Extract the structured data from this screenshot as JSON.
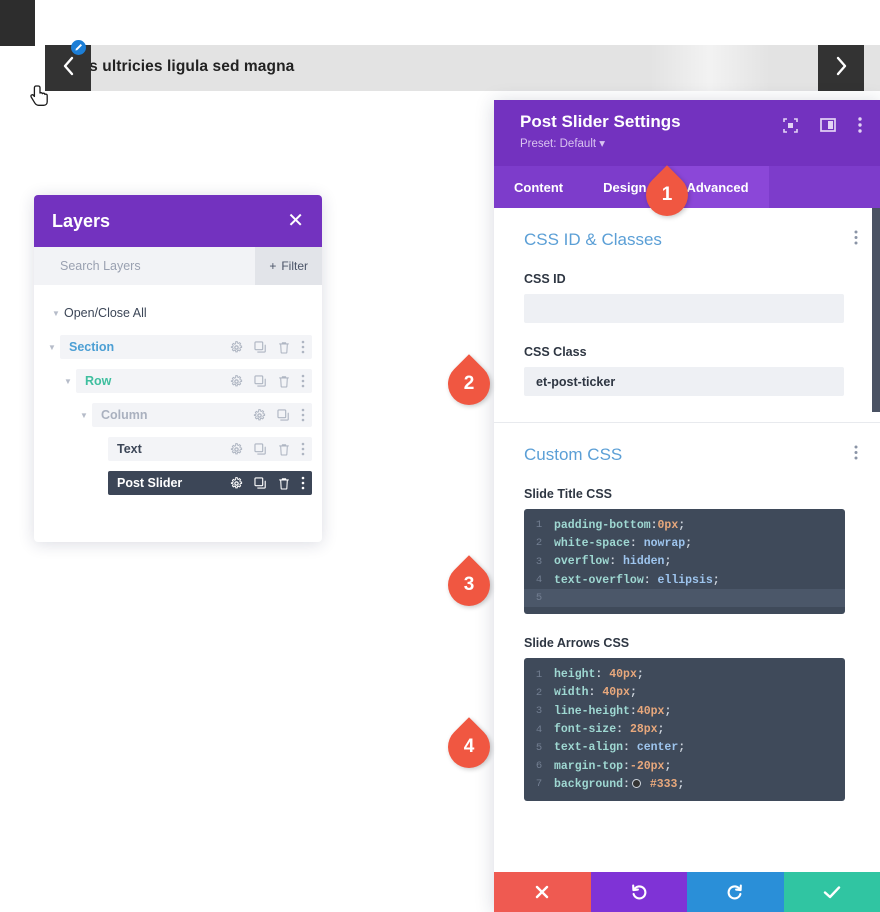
{
  "slider": {
    "title": "Cras ultricies ligula sed magna",
    "prev_arrow_icon": "chevron-left-icon",
    "next_arrow_icon": "chevron-right-icon",
    "badge_icon": "edit-pencil-icon"
  },
  "layers": {
    "title": "Layers",
    "close_label": "✕",
    "search_placeholder": "Search Layers",
    "search_value": "",
    "filter_label": "Filter",
    "filter_plus": "+",
    "open_close_all": "Open/Close All",
    "items": [
      {
        "label": "Section",
        "type": "section",
        "depth": 0,
        "has_caret": true,
        "has_delete": true,
        "selected": false
      },
      {
        "label": "Row",
        "type": "row",
        "depth": 1,
        "has_caret": true,
        "has_delete": true,
        "selected": false
      },
      {
        "label": "Column",
        "type": "column",
        "depth": 2,
        "has_caret": true,
        "has_delete": false,
        "selected": false
      },
      {
        "label": "Text",
        "type": "text",
        "depth": 3,
        "has_caret": false,
        "has_delete": true,
        "selected": false
      },
      {
        "label": "Post Slider",
        "type": "module",
        "depth": 3,
        "has_caret": false,
        "has_delete": true,
        "selected": true
      }
    ],
    "row_icons": [
      "gear-icon",
      "duplicate-icon",
      "trash-icon",
      "dots-vertical-icon"
    ],
    "accent": "#7332bf"
  },
  "settings": {
    "title": "Post Slider Settings",
    "preset": "Preset: Default ▾",
    "header_icons": [
      "expand-icon",
      "layout-panel-icon",
      "dots-vertical-icon"
    ],
    "tabs": [
      {
        "label": "Content",
        "active": false
      },
      {
        "label": "Design",
        "active": false
      },
      {
        "label": "Advanced",
        "active": true
      }
    ],
    "accent": "#7332bf",
    "tab_bar_color": "#7d3ccb",
    "sections": [
      {
        "heading": "CSS ID & Classes",
        "fields": [
          {
            "label": "CSS ID",
            "value": "",
            "name": "css-id-input"
          },
          {
            "label": "CSS Class",
            "value": "et-post-ticker",
            "name": "css-class-input"
          }
        ]
      },
      {
        "heading": "Custom CSS",
        "editors": [
          {
            "label": "Slide Title CSS",
            "name": "slide-title-css-editor",
            "lines": [
              {
                "n": "1",
                "prop": "padding-bottom",
                "sep": ":",
                "val": "0px",
                "val_kind": "num",
                "end": ";"
              },
              {
                "n": "2",
                "prop": "white-space",
                "sep": ": ",
                "val": "nowrap",
                "val_kind": "val",
                "end": ";"
              },
              {
                "n": "3",
                "prop": "overflow",
                "sep": ": ",
                "val": "hidden",
                "val_kind": "val",
                "end": ";"
              },
              {
                "n": "4",
                "prop": "text-overflow",
                "sep": ": ",
                "val": "ellipsis",
                "val_kind": "val",
                "end": ";"
              },
              {
                "n": "5",
                "prop": "",
                "sep": "",
                "val": "",
                "val_kind": "cursor",
                "end": ""
              }
            ]
          },
          {
            "label": "Slide Arrows CSS",
            "name": "slide-arrows-css-editor",
            "lines": [
              {
                "n": "1",
                "prop": "height",
                "sep": ": ",
                "val": "40px",
                "val_kind": "num",
                "end": ";"
              },
              {
                "n": "2",
                "prop": "width",
                "sep": ": ",
                "val": "40px",
                "val_kind": "num",
                "end": ";"
              },
              {
                "n": "3",
                "prop": "line-height",
                "sep": ":",
                "val": "40px",
                "val_kind": "num",
                "end": ";"
              },
              {
                "n": "4",
                "prop": "font-size",
                "sep": ": ",
                "val": "28px",
                "val_kind": "num",
                "end": ";"
              },
              {
                "n": "5",
                "prop": "text-align",
                "sep": ": ",
                "val": "center",
                "val_kind": "val",
                "end": ";"
              },
              {
                "n": "6",
                "prop": "margin-top",
                "sep": ":",
                "val": "-20px",
                "val_kind": "num",
                "end": ";"
              },
              {
                "n": "7",
                "prop": "background",
                "sep": ":",
                "val": "#333",
                "val_kind": "color",
                "end": ";",
                "swatch": "#333333"
              }
            ]
          }
        ]
      }
    ],
    "actions": [
      {
        "name": "cancel-button",
        "icon": "close-icon",
        "color": "#ef5a51"
      },
      {
        "name": "undo-button",
        "icon": "undo-icon",
        "color": "#7f33d6"
      },
      {
        "name": "redo-button",
        "icon": "redo-icon",
        "color": "#2a8fd8"
      },
      {
        "name": "save-button",
        "icon": "checkmark-icon",
        "color": "#30c5a2"
      }
    ]
  },
  "callouts": [
    {
      "number": "1"
    },
    {
      "number": "2"
    },
    {
      "number": "3"
    },
    {
      "number": "4"
    }
  ]
}
